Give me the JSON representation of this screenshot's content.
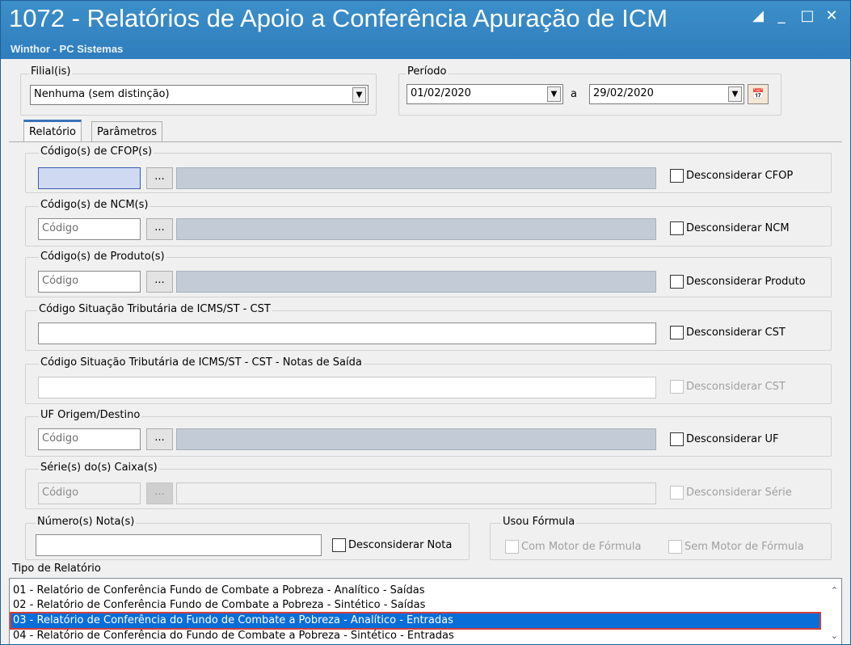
{
  "window": {
    "title": "1072 - Relatórios de Apoio a Conferência Apuração de ICM",
    "subtitle": "Winthor - PC Sistemas"
  },
  "filial": {
    "label": "Filial(is)",
    "value": "Nenhuma (sem distinção)"
  },
  "periodo": {
    "label": "Período",
    "start": "01/02/2020",
    "separator": "a",
    "end": "29/02/2020"
  },
  "tabs": [
    {
      "label": "Relatório"
    },
    {
      "label": "Parâmetros"
    }
  ],
  "common": {
    "codigo_placeholder": "Código",
    "ellipsis": "..."
  },
  "cfop": {
    "label": "Código(s) de CFOP(s)",
    "check": "Desconsiderar CFOP"
  },
  "ncm": {
    "label": "Código(s) de NCM(s)",
    "check": "Desconsiderar NCM"
  },
  "produto": {
    "label": "Código(s) de Produto(s)",
    "check": "Desconsiderar Produto"
  },
  "cst": {
    "label": "Código Situação Tributária de ICMS/ST - CST",
    "check": "Desconsiderar CST"
  },
  "cst_saida": {
    "label": "Código Situação Tributária de ICMS/ST - CST -  Notas de Saída",
    "check": "Desconsiderar CST"
  },
  "uf": {
    "label": "UF Origem/Destino",
    "check": "Desconsiderar UF"
  },
  "serie": {
    "label": "Série(s) do(s) Caixa(s)",
    "check": "Desconsiderar Série"
  },
  "nota": {
    "label": "Número(s) Nota(s)",
    "check": "Desconsiderar Nota"
  },
  "formula": {
    "label": "Usou Fórmula",
    "com": "Com Motor de Fórmula",
    "sem": "Sem Motor de Fórmula"
  },
  "tipo_relatorio": {
    "label": "Tipo de Relatório",
    "items": [
      "01 - Relatório de Conferência Fundo de Combate a Pobreza - Analítico - Saídas",
      "02 - Relatório de Conferência Fundo de Combate a Pobreza - Sintético - Saídas",
      "03 - Relatório de Conferência do Fundo de Combate a Pobreza - Analítico - Entradas",
      "04 - Relatório de Conferência do Fundo de Combate a Pobreza - Sintético - Entradas"
    ],
    "selected_index": 2
  },
  "colors": {
    "titlebar": "#2f7dbd",
    "selection": "#0a6ed8",
    "desc_field": "#c2cbd6"
  }
}
